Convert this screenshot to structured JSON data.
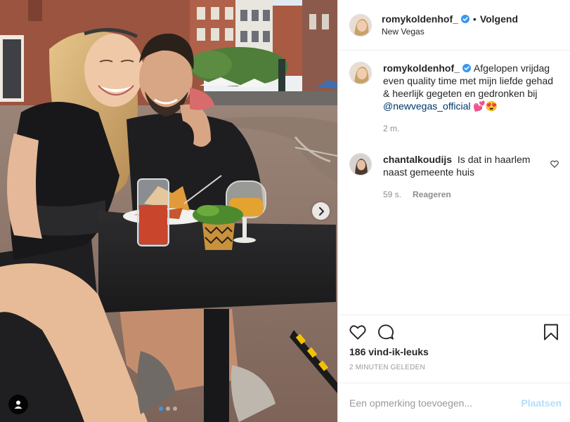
{
  "post": {
    "username": "romykoldenhof_",
    "verified": true,
    "separator": "•",
    "follow_label": "Volgend",
    "location": "New Vegas"
  },
  "caption": {
    "username": "romykoldenhof_",
    "text_1": "Afgelopen vrijdag even quality time met mijn liefde gehad & heerlijk gegeten en gedronken bij ",
    "mention": "@newvegas_official",
    "emoji": " 💕😍",
    "time": "2 m."
  },
  "comments": [
    {
      "username": "chantalkoudijs",
      "text": "Is dat in haarlem naast gemeente huis",
      "time": "59 s.",
      "reply_label": "Reageren"
    }
  ],
  "likes": "186 vind-ik-leuks",
  "timestamp": "2 MINUTEN GELEDEN",
  "comment_input": {
    "placeholder": "Een opmerking toevoegen...",
    "post_label": "Plaatsen"
  },
  "carousel": {
    "slides": 3,
    "active_index": 0
  },
  "colors": {
    "accent": "#3897f0",
    "post_disabled": "#b2dffc",
    "mention": "#003569",
    "muted": "#8e8e8e"
  },
  "icons": [
    "heart-icon",
    "comment-icon",
    "bookmark-icon",
    "verified-badge-icon",
    "chevron-right-icon",
    "user-tag-icon"
  ]
}
